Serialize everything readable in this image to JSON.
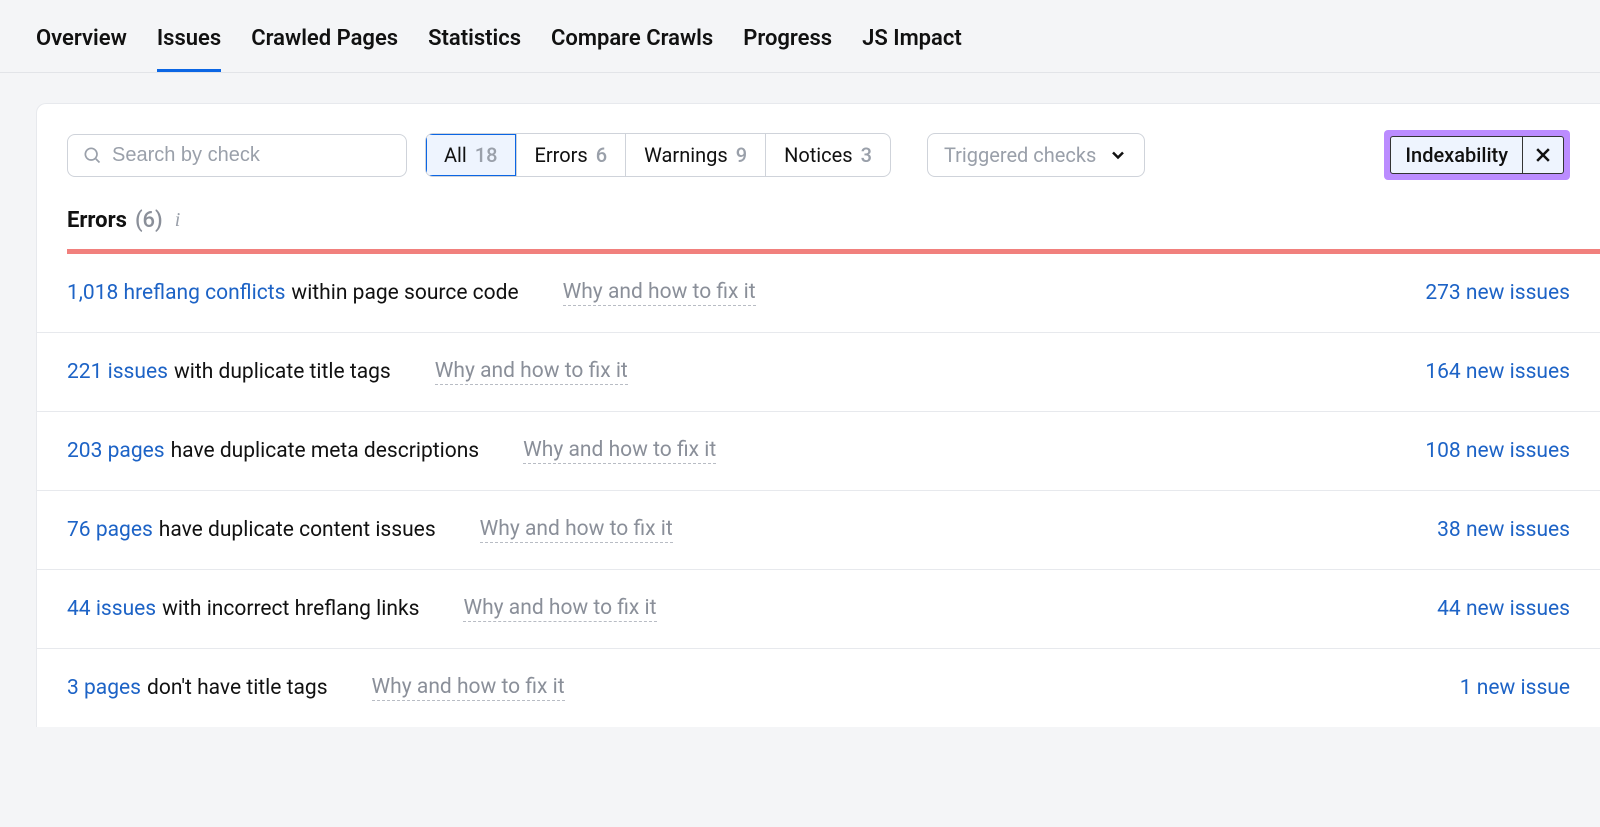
{
  "tabs": [
    "Overview",
    "Issues",
    "Crawled Pages",
    "Statistics",
    "Compare Crawls",
    "Progress",
    "JS Impact"
  ],
  "active_tab": 1,
  "search": {
    "placeholder": "Search by check"
  },
  "filters": {
    "all": {
      "label": "All",
      "count": "18"
    },
    "errors": {
      "label": "Errors",
      "count": "6"
    },
    "warnings": {
      "label": "Warnings",
      "count": "9"
    },
    "notices": {
      "label": "Notices",
      "count": "3"
    }
  },
  "dropdown": {
    "label": "Triggered checks"
  },
  "chip": {
    "label": "Indexability"
  },
  "section": {
    "name": "Errors",
    "count": "(6)"
  },
  "hint_label": "Why and how to fix it",
  "rows": [
    {
      "lead": "1,018 hreflang conflicts",
      "rest": "within page source code",
      "new": "273 new issues"
    },
    {
      "lead": "221 issues",
      "rest": "with duplicate title tags",
      "new": "164 new issues"
    },
    {
      "lead": "203 pages",
      "rest": "have duplicate meta descriptions",
      "new": "108 new issues"
    },
    {
      "lead": "76 pages",
      "rest": "have duplicate content issues",
      "new": "38 new issues"
    },
    {
      "lead": "44 issues",
      "rest": "with incorrect hreflang links",
      "new": "44 new issues"
    },
    {
      "lead": "3 pages",
      "rest": "don't have title tags",
      "new": "1 new issue"
    }
  ]
}
